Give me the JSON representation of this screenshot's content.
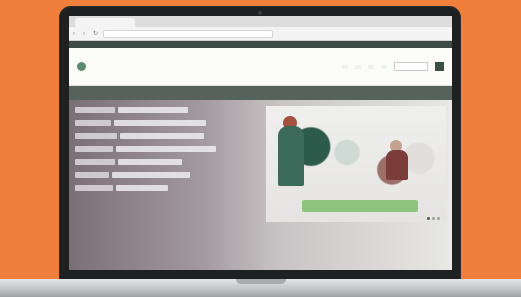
{
  "browser": {
    "tab_title": "",
    "url": ""
  },
  "site": {
    "logo_text": "",
    "nav_items": [
      "",
      "",
      "",
      ""
    ],
    "banner_text": ""
  },
  "hero": {
    "caption": ""
  },
  "colors": {
    "background": "#ef7f3a",
    "banner": "#55635c",
    "accent_green": "#8fc47e"
  }
}
